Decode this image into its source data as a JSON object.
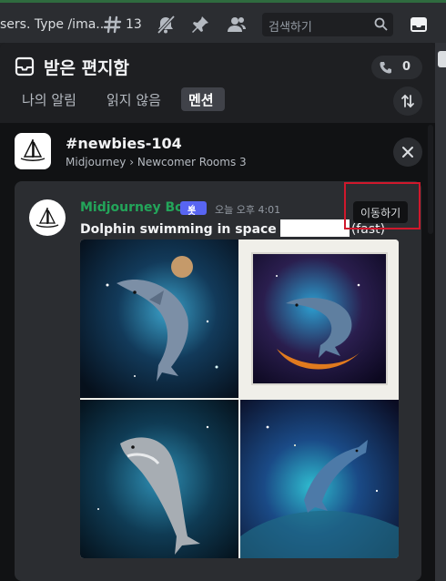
{
  "topbar": {
    "truncated_text": "sers. Type /ima...",
    "thread_count": "13",
    "search_placeholder": "검색하기",
    "icons": [
      "threads-icon",
      "mute-bell-icon",
      "pin-icon",
      "members-icon",
      "search-icon",
      "inbox-icon"
    ]
  },
  "inbox": {
    "title": "받은 편지함",
    "unread_count": "0",
    "tabs": [
      {
        "label": "나의 알림",
        "active": false
      },
      {
        "label": "읽지 않음",
        "active": false
      },
      {
        "label": "멘션",
        "active": true
      }
    ]
  },
  "channel": {
    "name": "newbies-104",
    "server": "Midjourney",
    "category": "Newcomer Rooms 3"
  },
  "message": {
    "author": "Midjourney Bot",
    "bot_tag": "봇",
    "timestamp": "오늘 오후 4:01",
    "prompt": "Dolphin swimming in space",
    "suffix": "(fast)",
    "jump_label": "이동하기"
  },
  "colors": {
    "accent": "#5865f2",
    "author_green": "#23a55a",
    "highlight_red": "#d0182c"
  }
}
